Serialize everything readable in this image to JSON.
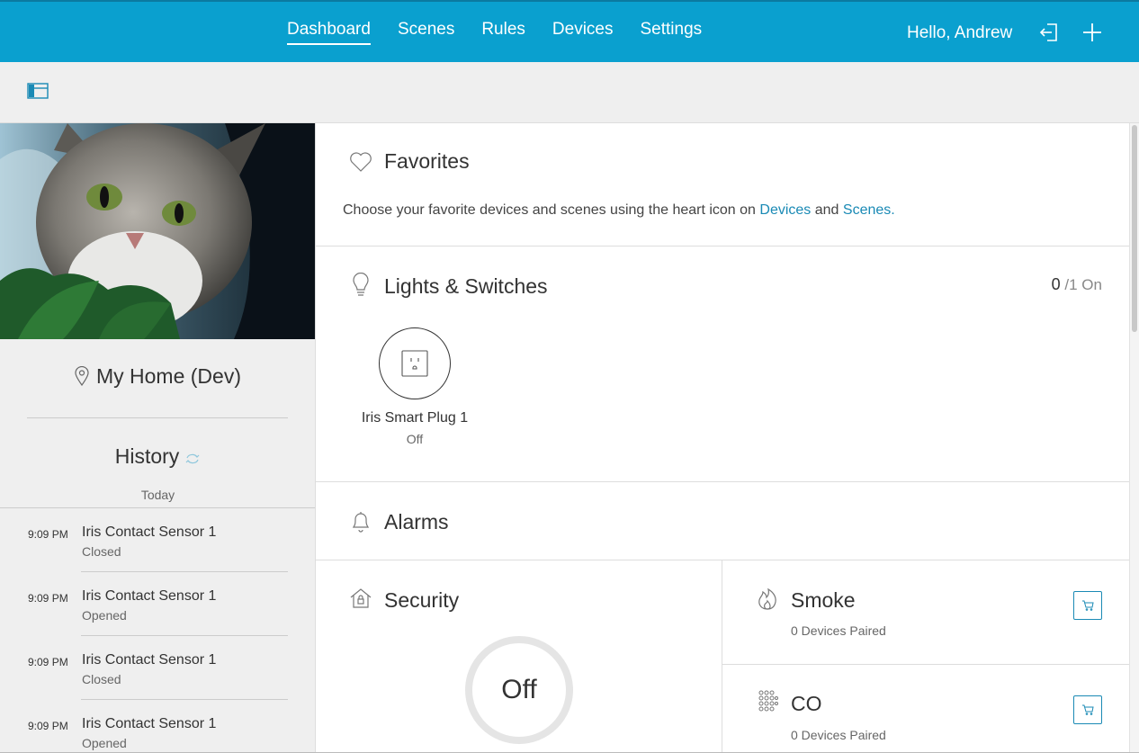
{
  "nav": {
    "items": [
      {
        "label": "Dashboard",
        "active": true
      },
      {
        "label": "Scenes",
        "active": false
      },
      {
        "label": "Rules",
        "active": false
      },
      {
        "label": "Devices",
        "active": false
      },
      {
        "label": "Settings",
        "active": false
      }
    ],
    "greeting": "Hello, Andrew"
  },
  "sidebar": {
    "home_name": "My Home (Dev)",
    "history_title": "History",
    "history_day": "Today",
    "history": [
      {
        "time": "9:09 PM",
        "device": "Iris Contact Sensor 1",
        "state": "Closed"
      },
      {
        "time": "9:09 PM",
        "device": "Iris Contact Sensor 1",
        "state": "Opened"
      },
      {
        "time": "9:09 PM",
        "device": "Iris Contact Sensor 1",
        "state": "Closed"
      },
      {
        "time": "9:09 PM",
        "device": "Iris Contact Sensor 1",
        "state": "Opened"
      }
    ]
  },
  "favorites": {
    "title": "Favorites",
    "desc_prefix": "Choose your favorite devices and scenes using the heart icon on ",
    "link_devices": "Devices",
    "desc_and": " and ",
    "link_scenes": "Scenes",
    "desc_suffix": "."
  },
  "lights": {
    "title": "Lights & Switches",
    "on_count": "0",
    "total_label": "/1 On",
    "device_name": "Iris Smart Plug 1",
    "device_state": "Off"
  },
  "alarms": {
    "title": "Alarms"
  },
  "security": {
    "title": "Security",
    "status": "Off"
  },
  "smoke": {
    "title": "Smoke",
    "subtitle": "0 Devices Paired"
  },
  "co": {
    "title": "CO",
    "subtitle": "0 Devices Paired"
  },
  "colors": {
    "accent": "#0aa0cf",
    "link": "#1a8ab5"
  }
}
